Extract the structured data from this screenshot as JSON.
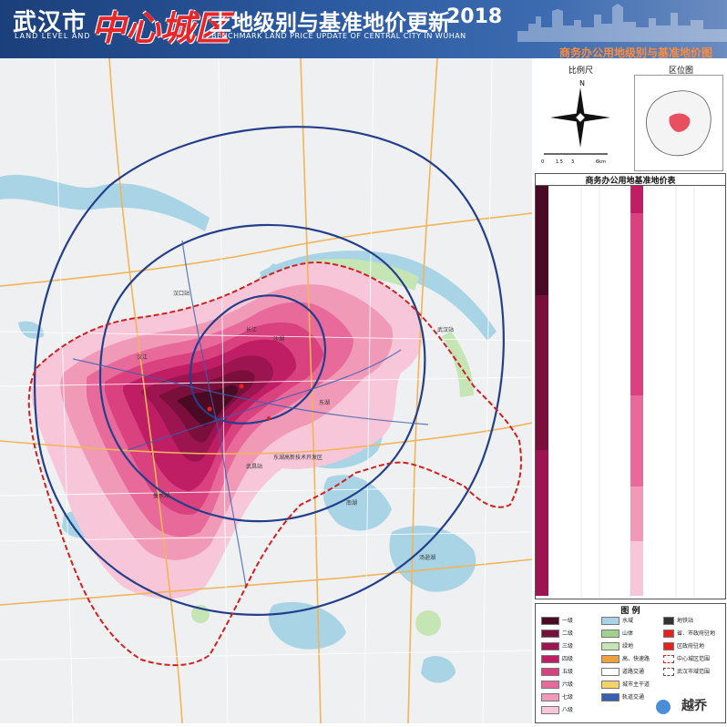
{
  "header": {
    "city": "武汉市",
    "city_en": "LAND LEVEL AND",
    "area": "中心城区",
    "title": "土地级别与基准地价更新",
    "title_en": "BENCHMARK LAND PRICE UPDATE OF CENTRAL CITY IN WUHAN",
    "year": "2018",
    "subtitle": "商务办公用地级别与基准地价图"
  },
  "side": {
    "scale_title": "比例尺",
    "location_title": "区位图",
    "north": "N",
    "scale_ticks": [
      "0",
      "1.5",
      "3",
      "6km"
    ],
    "table_title": "商务办公用地基准地价表"
  },
  "legend": {
    "title": "图    例",
    "levels": [
      {
        "label": "一级",
        "color": "#4a0a24"
      },
      {
        "label": "二级",
        "color": "#7a0f3c"
      },
      {
        "label": "三级",
        "color": "#9c1450"
      },
      {
        "label": "四级",
        "color": "#c01e64"
      },
      {
        "label": "五级",
        "color": "#d9417f"
      },
      {
        "label": "六级",
        "color": "#e86a9a"
      },
      {
        "label": "七级",
        "color": "#f09ab8"
      },
      {
        "label": "八级",
        "color": "#f7c6d8"
      }
    ],
    "features": [
      {
        "label": "水域",
        "color": "#a8d4e6"
      },
      {
        "label": "山体",
        "color": "#9fd18f"
      },
      {
        "label": "绿地",
        "color": "#c6e5b4"
      },
      {
        "label": "高、快速路",
        "color": "#f0a040"
      },
      {
        "label": "道路交通",
        "color": "#ffffff"
      },
      {
        "label": "城市主干道",
        "color": "#f6d36a"
      },
      {
        "label": "轨道交通",
        "color": "#3a5fb0"
      }
    ],
    "marks": [
      {
        "label": "地铁站",
        "color": "#333333"
      },
      {
        "label": "省、市政府驻地",
        "color": "#e82020"
      },
      {
        "label": "区政府驻地",
        "color": "#e82020"
      },
      {
        "label": "中心城区范围",
        "color": "#d02020"
      },
      {
        "label": "武汉市域范围",
        "color": "#555555"
      }
    ]
  },
  "map": {
    "water": "#a8d4e6",
    "green": "#c6e5b4",
    "ring_road": "#233f8a",
    "boundary": "#d02020",
    "road": "#f2b458",
    "base": "#eef0f1",
    "labels": [
      "长江",
      "汉江",
      "东湖",
      "南湖",
      "汤逊湖",
      "沙湖",
      "墨水湖",
      "武汉站",
      "汉口站",
      "武昌站",
      "东湖高新技术开发区"
    ]
  },
  "watermark": "越乔"
}
